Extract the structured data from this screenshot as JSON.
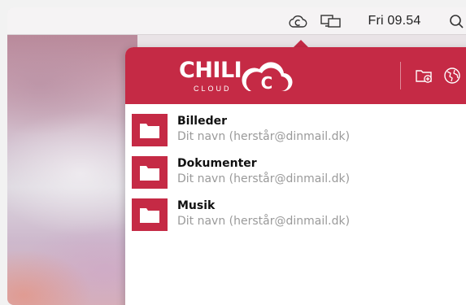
{
  "menubar": {
    "clock": "Fri 09.54",
    "icons": [
      "chili-cloud-menubar-icon",
      "display-mirroring-icon",
      "spotlight-search-icon"
    ]
  },
  "app": {
    "logo_word": "CHILI",
    "logo_badge": "C",
    "logo_sub": "CLOUD",
    "accent_color": "#c52a45",
    "header_icons": [
      "new-folder-icon",
      "globe-icon"
    ]
  },
  "folders": [
    {
      "name": "Billeder",
      "owner": "Dit navn (herstår@dinmail.dk)"
    },
    {
      "name": "Dokumenter",
      "owner": "Dit navn (herstår@dinmail.dk)"
    },
    {
      "name": "Musik",
      "owner": "Dit navn (herstår@dinmail.dk)"
    }
  ]
}
